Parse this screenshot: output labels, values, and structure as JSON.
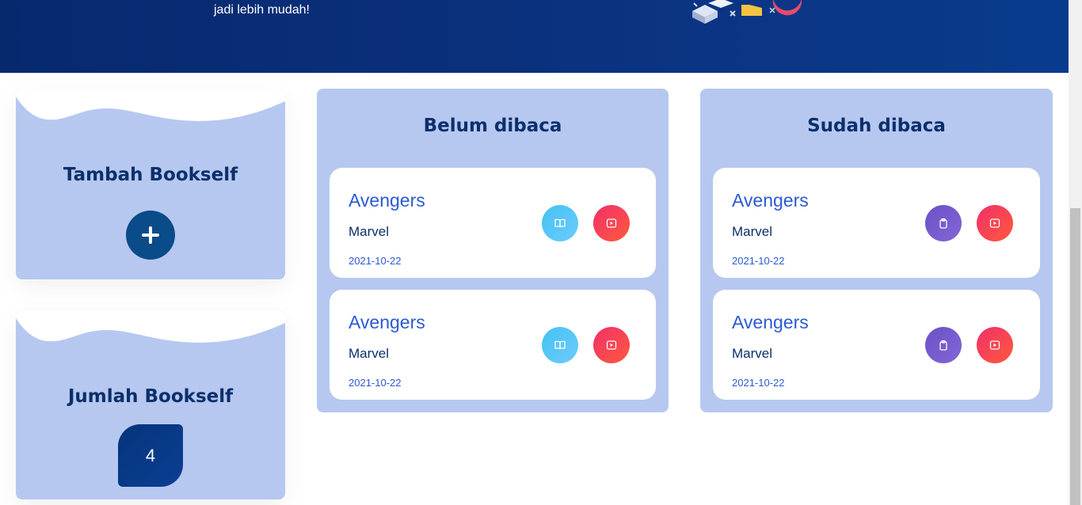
{
  "header": {
    "subtitle": "jadi lebih mudah!"
  },
  "sidebar": {
    "add_title": "Tambah Bookself",
    "count_title": "Jumlah Bookself",
    "count_value": "4"
  },
  "shelves": {
    "unread": {
      "title": "Belum dibaca",
      "books": [
        {
          "title": "Avengers",
          "author": "Marvel",
          "date": "2021-10-22"
        },
        {
          "title": "Avengers",
          "author": "Marvel",
          "date": "2021-10-22"
        }
      ]
    },
    "read": {
      "title": "Sudah dibaca",
      "books": [
        {
          "title": "Avengers",
          "author": "Marvel",
          "date": "2021-10-22"
        },
        {
          "title": "Avengers",
          "author": "Marvel",
          "date": "2021-10-22"
        }
      ]
    }
  },
  "icons": {
    "add": "plus-icon",
    "mark_read": "book-open-icon",
    "mark_unread": "clipboard-icon",
    "delete": "play-square-icon"
  },
  "colors": {
    "header": "#0a2f7a",
    "panel": "#b6c8f0",
    "title": "#0b2f6b",
    "link": "#2b5ad3",
    "blue_button": "#4fc4f6",
    "red_button": "#f63d58",
    "purple_button": "#7559cc"
  }
}
